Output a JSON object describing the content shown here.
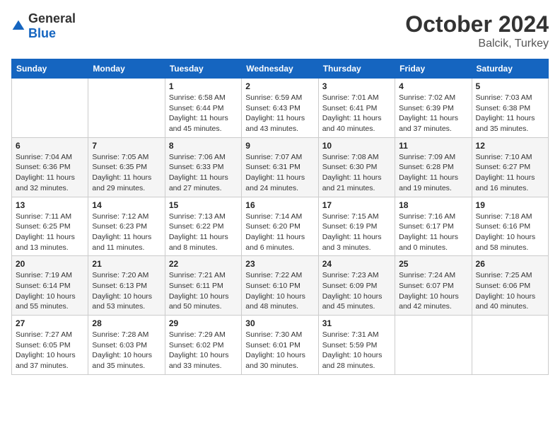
{
  "header": {
    "logo_general": "General",
    "logo_blue": "Blue",
    "month_title": "October 2024",
    "location": "Balcik, Turkey"
  },
  "weekdays": [
    "Sunday",
    "Monday",
    "Tuesday",
    "Wednesday",
    "Thursday",
    "Friday",
    "Saturday"
  ],
  "weeks": [
    [
      {
        "day": "",
        "sunrise": "",
        "sunset": "",
        "daylight": ""
      },
      {
        "day": "",
        "sunrise": "",
        "sunset": "",
        "daylight": ""
      },
      {
        "day": "1",
        "sunrise": "Sunrise: 6:58 AM",
        "sunset": "Sunset: 6:44 PM",
        "daylight": "Daylight: 11 hours and 45 minutes."
      },
      {
        "day": "2",
        "sunrise": "Sunrise: 6:59 AM",
        "sunset": "Sunset: 6:43 PM",
        "daylight": "Daylight: 11 hours and 43 minutes."
      },
      {
        "day": "3",
        "sunrise": "Sunrise: 7:01 AM",
        "sunset": "Sunset: 6:41 PM",
        "daylight": "Daylight: 11 hours and 40 minutes."
      },
      {
        "day": "4",
        "sunrise": "Sunrise: 7:02 AM",
        "sunset": "Sunset: 6:39 PM",
        "daylight": "Daylight: 11 hours and 37 minutes."
      },
      {
        "day": "5",
        "sunrise": "Sunrise: 7:03 AM",
        "sunset": "Sunset: 6:38 PM",
        "daylight": "Daylight: 11 hours and 35 minutes."
      }
    ],
    [
      {
        "day": "6",
        "sunrise": "Sunrise: 7:04 AM",
        "sunset": "Sunset: 6:36 PM",
        "daylight": "Daylight: 11 hours and 32 minutes."
      },
      {
        "day": "7",
        "sunrise": "Sunrise: 7:05 AM",
        "sunset": "Sunset: 6:35 PM",
        "daylight": "Daylight: 11 hours and 29 minutes."
      },
      {
        "day": "8",
        "sunrise": "Sunrise: 7:06 AM",
        "sunset": "Sunset: 6:33 PM",
        "daylight": "Daylight: 11 hours and 27 minutes."
      },
      {
        "day": "9",
        "sunrise": "Sunrise: 7:07 AM",
        "sunset": "Sunset: 6:31 PM",
        "daylight": "Daylight: 11 hours and 24 minutes."
      },
      {
        "day": "10",
        "sunrise": "Sunrise: 7:08 AM",
        "sunset": "Sunset: 6:30 PM",
        "daylight": "Daylight: 11 hours and 21 minutes."
      },
      {
        "day": "11",
        "sunrise": "Sunrise: 7:09 AM",
        "sunset": "Sunset: 6:28 PM",
        "daylight": "Daylight: 11 hours and 19 minutes."
      },
      {
        "day": "12",
        "sunrise": "Sunrise: 7:10 AM",
        "sunset": "Sunset: 6:27 PM",
        "daylight": "Daylight: 11 hours and 16 minutes."
      }
    ],
    [
      {
        "day": "13",
        "sunrise": "Sunrise: 7:11 AM",
        "sunset": "Sunset: 6:25 PM",
        "daylight": "Daylight: 11 hours and 13 minutes."
      },
      {
        "day": "14",
        "sunrise": "Sunrise: 7:12 AM",
        "sunset": "Sunset: 6:23 PM",
        "daylight": "Daylight: 11 hours and 11 minutes."
      },
      {
        "day": "15",
        "sunrise": "Sunrise: 7:13 AM",
        "sunset": "Sunset: 6:22 PM",
        "daylight": "Daylight: 11 hours and 8 minutes."
      },
      {
        "day": "16",
        "sunrise": "Sunrise: 7:14 AM",
        "sunset": "Sunset: 6:20 PM",
        "daylight": "Daylight: 11 hours and 6 minutes."
      },
      {
        "day": "17",
        "sunrise": "Sunrise: 7:15 AM",
        "sunset": "Sunset: 6:19 PM",
        "daylight": "Daylight: 11 hours and 3 minutes."
      },
      {
        "day": "18",
        "sunrise": "Sunrise: 7:16 AM",
        "sunset": "Sunset: 6:17 PM",
        "daylight": "Daylight: 11 hours and 0 minutes."
      },
      {
        "day": "19",
        "sunrise": "Sunrise: 7:18 AM",
        "sunset": "Sunset: 6:16 PM",
        "daylight": "Daylight: 10 hours and 58 minutes."
      }
    ],
    [
      {
        "day": "20",
        "sunrise": "Sunrise: 7:19 AM",
        "sunset": "Sunset: 6:14 PM",
        "daylight": "Daylight: 10 hours and 55 minutes."
      },
      {
        "day": "21",
        "sunrise": "Sunrise: 7:20 AM",
        "sunset": "Sunset: 6:13 PM",
        "daylight": "Daylight: 10 hours and 53 minutes."
      },
      {
        "day": "22",
        "sunrise": "Sunrise: 7:21 AM",
        "sunset": "Sunset: 6:11 PM",
        "daylight": "Daylight: 10 hours and 50 minutes."
      },
      {
        "day": "23",
        "sunrise": "Sunrise: 7:22 AM",
        "sunset": "Sunset: 6:10 PM",
        "daylight": "Daylight: 10 hours and 48 minutes."
      },
      {
        "day": "24",
        "sunrise": "Sunrise: 7:23 AM",
        "sunset": "Sunset: 6:09 PM",
        "daylight": "Daylight: 10 hours and 45 minutes."
      },
      {
        "day": "25",
        "sunrise": "Sunrise: 7:24 AM",
        "sunset": "Sunset: 6:07 PM",
        "daylight": "Daylight: 10 hours and 42 minutes."
      },
      {
        "day": "26",
        "sunrise": "Sunrise: 7:25 AM",
        "sunset": "Sunset: 6:06 PM",
        "daylight": "Daylight: 10 hours and 40 minutes."
      }
    ],
    [
      {
        "day": "27",
        "sunrise": "Sunrise: 7:27 AM",
        "sunset": "Sunset: 6:05 PM",
        "daylight": "Daylight: 10 hours and 37 minutes."
      },
      {
        "day": "28",
        "sunrise": "Sunrise: 7:28 AM",
        "sunset": "Sunset: 6:03 PM",
        "daylight": "Daylight: 10 hours and 35 minutes."
      },
      {
        "day": "29",
        "sunrise": "Sunrise: 7:29 AM",
        "sunset": "Sunset: 6:02 PM",
        "daylight": "Daylight: 10 hours and 33 minutes."
      },
      {
        "day": "30",
        "sunrise": "Sunrise: 7:30 AM",
        "sunset": "Sunset: 6:01 PM",
        "daylight": "Daylight: 10 hours and 30 minutes."
      },
      {
        "day": "31",
        "sunrise": "Sunrise: 7:31 AM",
        "sunset": "Sunset: 5:59 PM",
        "daylight": "Daylight: 10 hours and 28 minutes."
      },
      {
        "day": "",
        "sunrise": "",
        "sunset": "",
        "daylight": ""
      },
      {
        "day": "",
        "sunrise": "",
        "sunset": "",
        "daylight": ""
      }
    ]
  ]
}
